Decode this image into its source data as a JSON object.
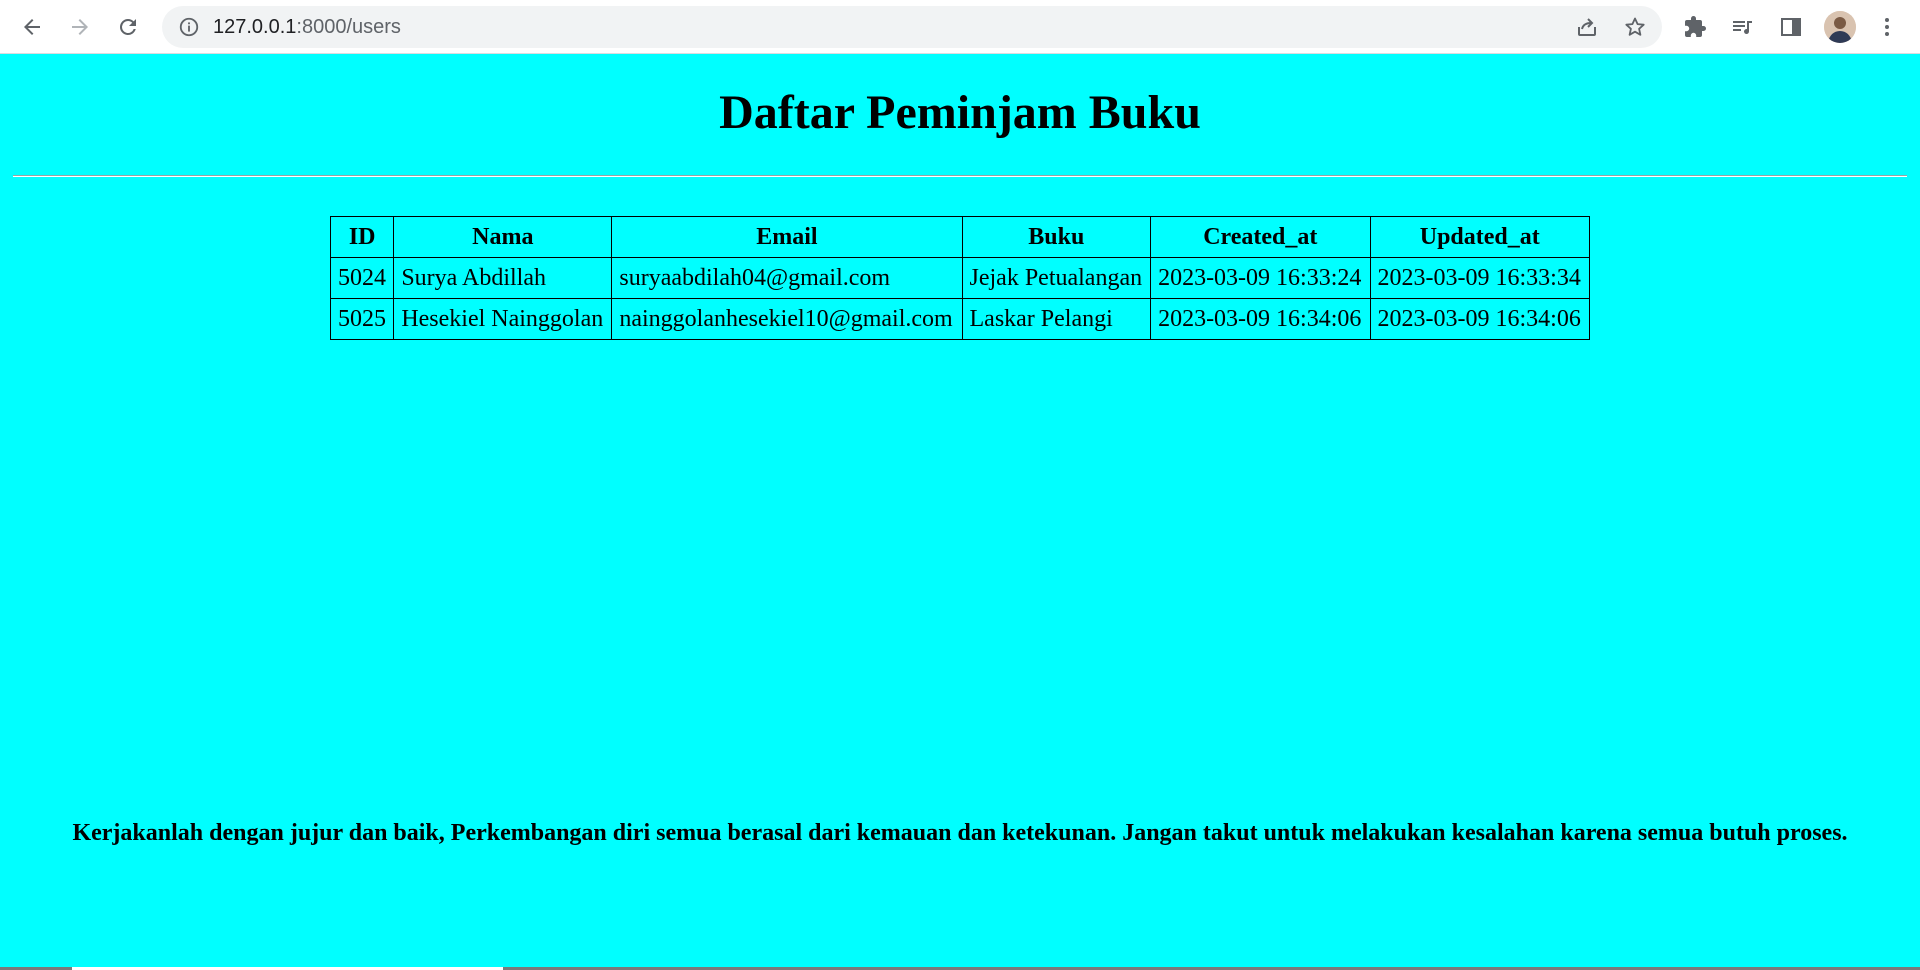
{
  "browser": {
    "url_host": "127.0.0.1",
    "url_path": ":8000/users",
    "icons": {
      "back": "arrow-left-icon",
      "forward": "arrow-right-icon",
      "reload": "reload-icon",
      "site_info": "info-icon",
      "share": "share-icon",
      "bookmark": "star-icon",
      "extensions": "puzzle-icon",
      "media": "media-queue-icon",
      "side_panel": "side-panel-icon",
      "menu": "kebab-menu-icon"
    }
  },
  "page": {
    "background": "#00ffff",
    "title": "Daftar Peminjam Buku",
    "table": {
      "headers": [
        "ID",
        "Nama",
        "Email",
        "Buku",
        "Created_at",
        "Updated_at"
      ],
      "rows": [
        [
          "5024",
          "Surya Abdillah",
          "suryaabdilah04@gmail.com",
          "Jejak Petualangan",
          "2023-03-09 16:33:24",
          "2023-03-09 16:33:34"
        ],
        [
          "5025",
          "Hesekiel Nainggolan",
          "nainggolanhesekiel10@gmail.com",
          "Laskar Pelangi",
          "2023-03-09 16:34:06",
          "2023-03-09 16:34:06"
        ]
      ]
    },
    "quote": "Kerjakanlah dengan jujur dan baik, Perkembangan diri semua berasal dari kemauan dan ketekunan. Jangan takut untuk melakukan kesalahan karena semua butuh proses."
  }
}
